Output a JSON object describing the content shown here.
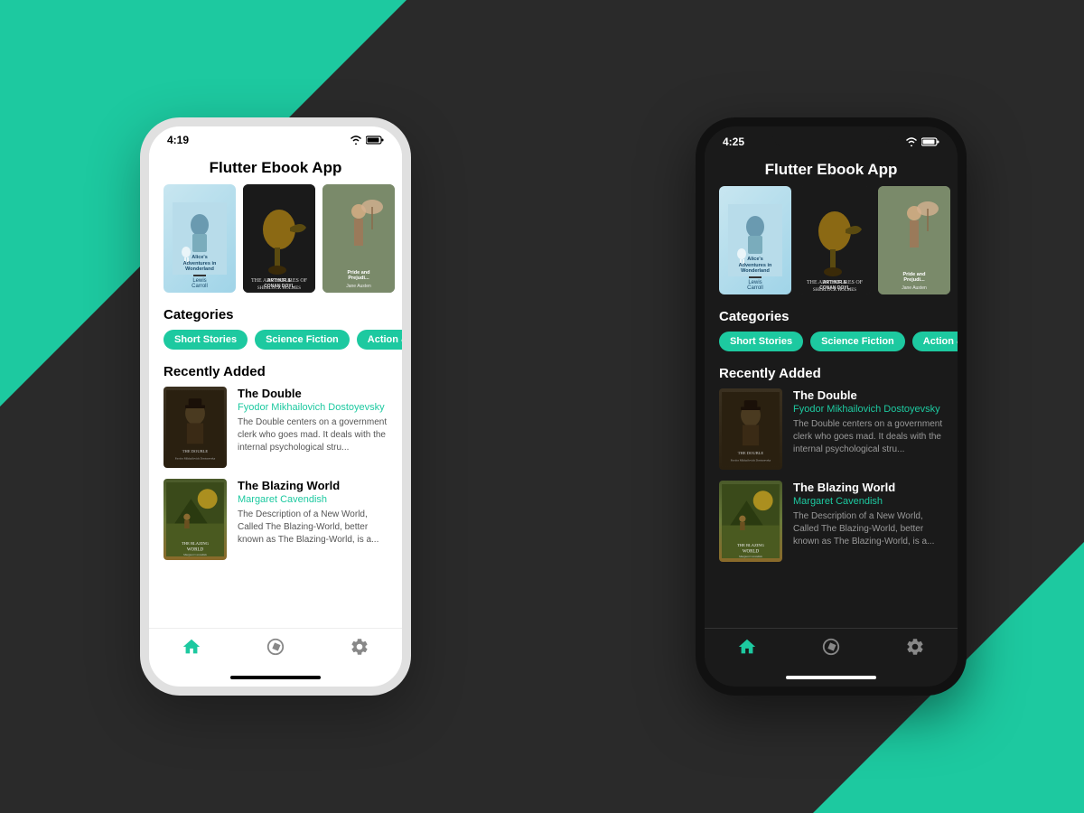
{
  "background": {
    "main_color": "#2a2a2a",
    "teal_color": "#1dc9a0"
  },
  "phone_white": {
    "status_time": "4:19",
    "app_title": "Flutter Ebook App",
    "books": [
      {
        "id": "alice",
        "title": "Alice's Adventures in Wonderland",
        "author": "Lewis Carroll",
        "color_top": "#c8e6f0",
        "color_bottom": "#a0d4e8"
      },
      {
        "id": "holmes",
        "title": "The Adventures of Sherlock Holmes",
        "author": "Arthur Conan Doyle",
        "color_top": "#2c2c2c",
        "color_bottom": "#1a1a1a"
      },
      {
        "id": "pride",
        "title": "Pride and Prejudice",
        "author": "Jane Austen",
        "color_top": "#8a9a7c",
        "color_bottom": "#6b7a5c"
      }
    ],
    "categories_label": "Categories",
    "categories": [
      "Short Stories",
      "Science Fiction",
      "Action & Adventure"
    ],
    "recently_added_label": "Recently Added",
    "recent_books": [
      {
        "id": "double",
        "title": "The Double",
        "author": "Fyodor Mikhailovich Dostoyevsky",
        "description": "The Double centers on a government clerk who goes mad. It deals with the internal psychological stru..."
      },
      {
        "id": "blazing",
        "title": "The Blazing World",
        "author": "Margaret Cavendish",
        "description": "The Description of a New World, Called The Blazing-World, better known as The Blazing-World, is a..."
      }
    ],
    "nav": {
      "home": "home",
      "explore": "explore",
      "settings": "settings"
    }
  },
  "phone_dark": {
    "status_time": "4:25",
    "app_title": "Flutter Ebook App",
    "books": [
      {
        "id": "alice",
        "title": "Alice's Adventures in Wonderland",
        "author": "Lewis Carroll"
      },
      {
        "id": "holmes",
        "title": "The Adventures of Sherlock Holmes",
        "author": "Arthur Conan Doyle"
      },
      {
        "id": "pride",
        "title": "Pride and Prejudice",
        "author": "Jane Austen"
      }
    ],
    "categories_label": "Categories",
    "categories": [
      "Short Stories",
      "Science Fiction",
      "Action & Adventure"
    ],
    "recently_added_label": "Recently Added",
    "recent_books": [
      {
        "id": "double",
        "title": "The Double",
        "author": "Fyodor Mikhailovich Dostoyevsky",
        "description": "The Double centers on a government clerk who goes mad. It deals with the internal psychological stru..."
      },
      {
        "id": "blazing",
        "title": "The Blazing World",
        "author": "Margaret Cavendish",
        "description": "The Description of a New World, Called The Blazing-World, better known as The Blazing-World, is a..."
      }
    ]
  }
}
